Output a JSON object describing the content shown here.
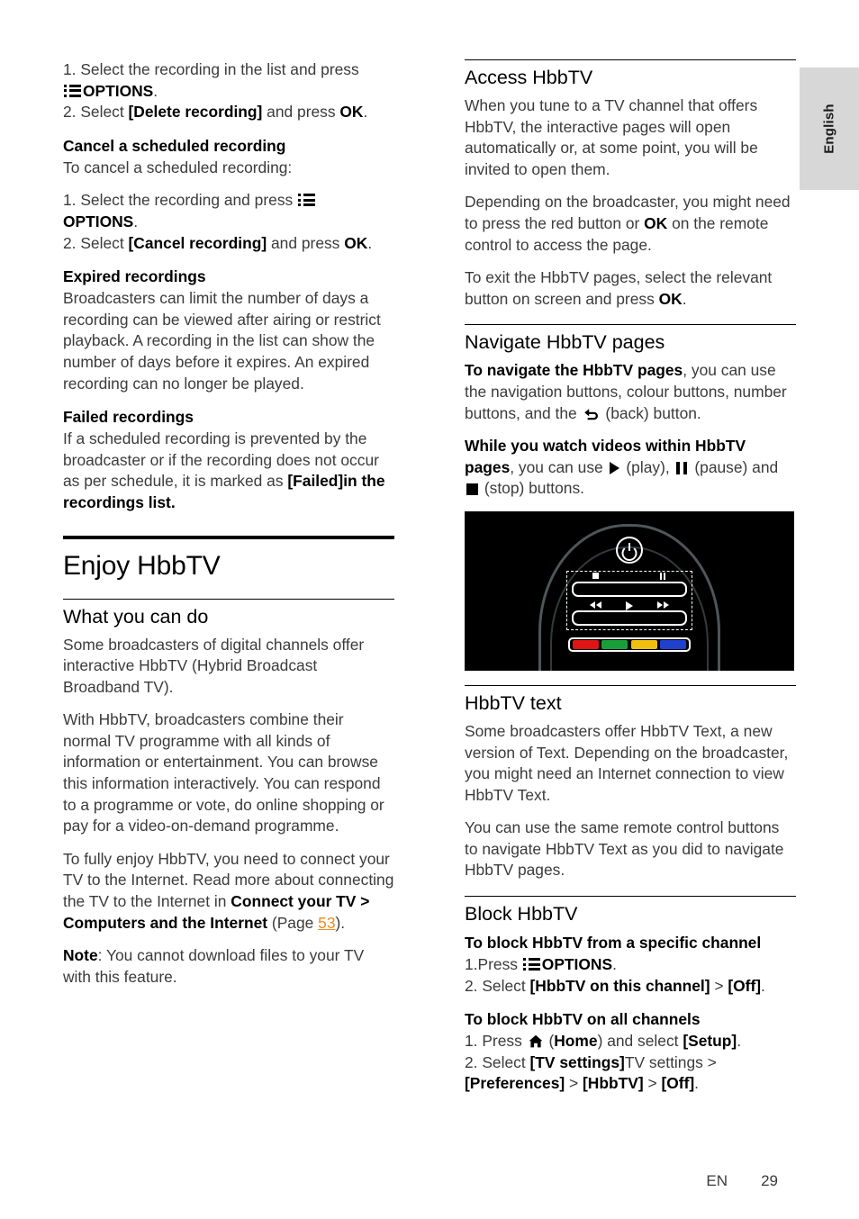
{
  "page": {
    "language_tab": "English",
    "footer_language": "EN",
    "footer_page_number": "29",
    "link_color": "#f08a1e"
  },
  "left_column": {
    "delete_recording_steps": {
      "step1_a": "1. Select the recording in the list and press ",
      "step1_icon": "options-icon",
      "step1_b": "OPTIONS",
      "step1_c": ".",
      "step2_a": "2. Select ",
      "step2_bold": "[Delete recording]",
      "step2_b": " and press ",
      "step2_ok": "OK",
      "step2_c": "."
    },
    "cancel_scheduled": {
      "heading": "Cancel a scheduled recording",
      "intro": "To cancel a scheduled recording:",
      "step1_a": "1. Select the recording and press ",
      "step1_icon": "options-icon",
      "step1_b": "OPTIONS",
      "step1_c": ".",
      "step2_a": "2. Select ",
      "step2_bold": "[Cancel recording]",
      "step2_b": " and press ",
      "step2_ok": "OK",
      "step2_c": "."
    },
    "expired_recordings": {
      "heading": "Expired recordings",
      "body": "Broadcasters can limit the number of days a recording can be viewed after airing or restrict playback. A recording in the list can show the number of days before it expires. An expired recording can no longer be played."
    },
    "failed_recordings": {
      "heading": "Failed recordings",
      "body_a": "If a scheduled recording is prevented by the broadcaster or if the recording does not occur as per schedule, it is marked as ",
      "body_bold": "[Failed]in the recordings list."
    },
    "chapter_title": "Enjoy HbbTV",
    "what_you_can_do": {
      "heading": "What you can do",
      "p1": "Some broadcasters of digital channels offer interactive HbbTV (Hybrid Broadcast Broadband TV).",
      "p2": "With HbbTV, broadcasters combine their normal TV programme with all kinds of information or entertainment. You can browse this information interactively. You can respond to a programme or vote, do online shopping or pay for a video-on-demand programme.",
      "p3_a": "To fully enjoy HbbTV, you need to connect your TV to the Internet. Read more about connecting the TV to the Internet in ",
      "p3_bold": "Connect your TV > Computers and the Internet",
      "p3_b": " (Page ",
      "p3_link": "53",
      "p3_c": ").",
      "p4_bold": "Note",
      "p4_a": ": You cannot download files to your TV with this feature."
    }
  },
  "right_column": {
    "access_hbbtv": {
      "heading": "Access HbbTV",
      "p1": "When you tune to a TV channel that offers HbbTV, the interactive pages will open automatically or, at some point, you will be invited to open them.",
      "p2_a": "Depending on the broadcaster, you might need to press the red button or ",
      "p2_ok": "OK",
      "p2_b": " on the remote control to access the page.",
      "p3_a": "To exit the HbbTV pages, select the relevant button on screen and press ",
      "p3_ok": "OK",
      "p3_b": "."
    },
    "navigate_pages": {
      "heading": "Navigate HbbTV pages",
      "p1_bold": "To navigate the HbbTV pages",
      "p1_a": ", you can use the navigation buttons, colour buttons, number buttons, and the ",
      "p1_icon": "back-icon",
      "p1_b": " (back) button.",
      "p2_bold": "While you watch videos within HbbTV pages",
      "p2_a": ", you can use ",
      "p2_play_icon": "play-icon",
      "p2_b": " (play), ",
      "p2_pause_icon": "pause-icon",
      "p2_c": " (pause) and ",
      "p2_stop_icon": "stop-icon",
      "p2_d": " (stop) buttons."
    },
    "remote_figure": {
      "alt": "Philips remote control top section with power, playback and colour buttons",
      "colour_buttons": [
        {
          "name": "red-key",
          "color": "#dd1515"
        },
        {
          "name": "green-key",
          "color": "#1a9e3a"
        },
        {
          "name": "yellow-key",
          "color": "#f0c010"
        },
        {
          "name": "blue-key",
          "color": "#2040d0"
        }
      ]
    },
    "hbbtv_text": {
      "heading": "HbbTV text",
      "p1": "Some broadcasters offer HbbTV Text, a new version of Text. Depending on the broadcaster, you might need an Internet connection to view HbbTV Text.",
      "p2": "You can use the same remote control buttons to navigate HbbTV Text as you did to navigate HbbTV pages."
    },
    "block_hbbtv": {
      "heading": "Block HbbTV",
      "sub1": "To block HbbTV from a specific channel",
      "s1_step1_a": "1.Press ",
      "s1_step1_icon": "options-icon",
      "s1_step1_b": "OPTIONS",
      "s1_step1_c": ".",
      "s1_step2_a": "2. Select ",
      "s1_step2_bold1": "[HbbTV on this channel]",
      "s1_step2_b": " > ",
      "s1_step2_bold2": "[Off]",
      "s1_step2_c": ".",
      "sub2": "To block HbbTV on all channels",
      "s2_step1_a": "1. Press ",
      "s2_step1_icon": "home-icon",
      "s2_step1_b": " (",
      "s2_step1_bold1": "Home",
      "s2_step1_c": ") and select ",
      "s2_step1_bold2": "[Setup]",
      "s2_step1_d": ".",
      "s2_step2_a": "2. Select ",
      "s2_step2_bold1": "[TV settings]",
      "s2_step2_b": "TV settings > ",
      "s2_step2_bold2": "[Preferences]",
      "s2_step2_c": " > ",
      "s2_step2_bold3": "[HbbTV]",
      "s2_step2_d": " > ",
      "s2_step2_bold4": "[Off]",
      "s2_step2_e": "."
    }
  }
}
